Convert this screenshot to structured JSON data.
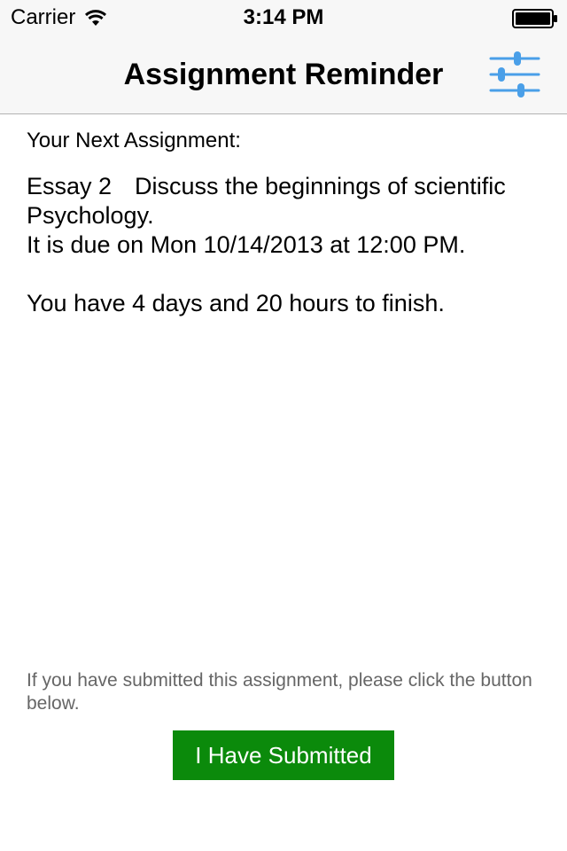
{
  "status_bar": {
    "carrier": "Carrier",
    "time": "3:14 PM",
    "wifi_icon": "wifi-icon",
    "battery_icon": "battery-icon"
  },
  "nav": {
    "title": "Assignment Reminder",
    "settings_icon": "sliders-icon",
    "accent_color": "#4a9fe8"
  },
  "content": {
    "heading": "Your Next Assignment:",
    "assignment_name": "Essay 2",
    "assignment_description_1": "Discuss the beginnings of scientific",
    "assignment_description_2": "Psychology.",
    "due_text": "It is due on Mon 10/14/2013 at 12:00 PM.",
    "time_left_text": "You have 4 days and 20 hours to finish."
  },
  "footer": {
    "hint": "If you have submitted this assignment, please click the button below.",
    "submit_label": "I Have Submitted",
    "submit_color": "#0b8a0b"
  }
}
